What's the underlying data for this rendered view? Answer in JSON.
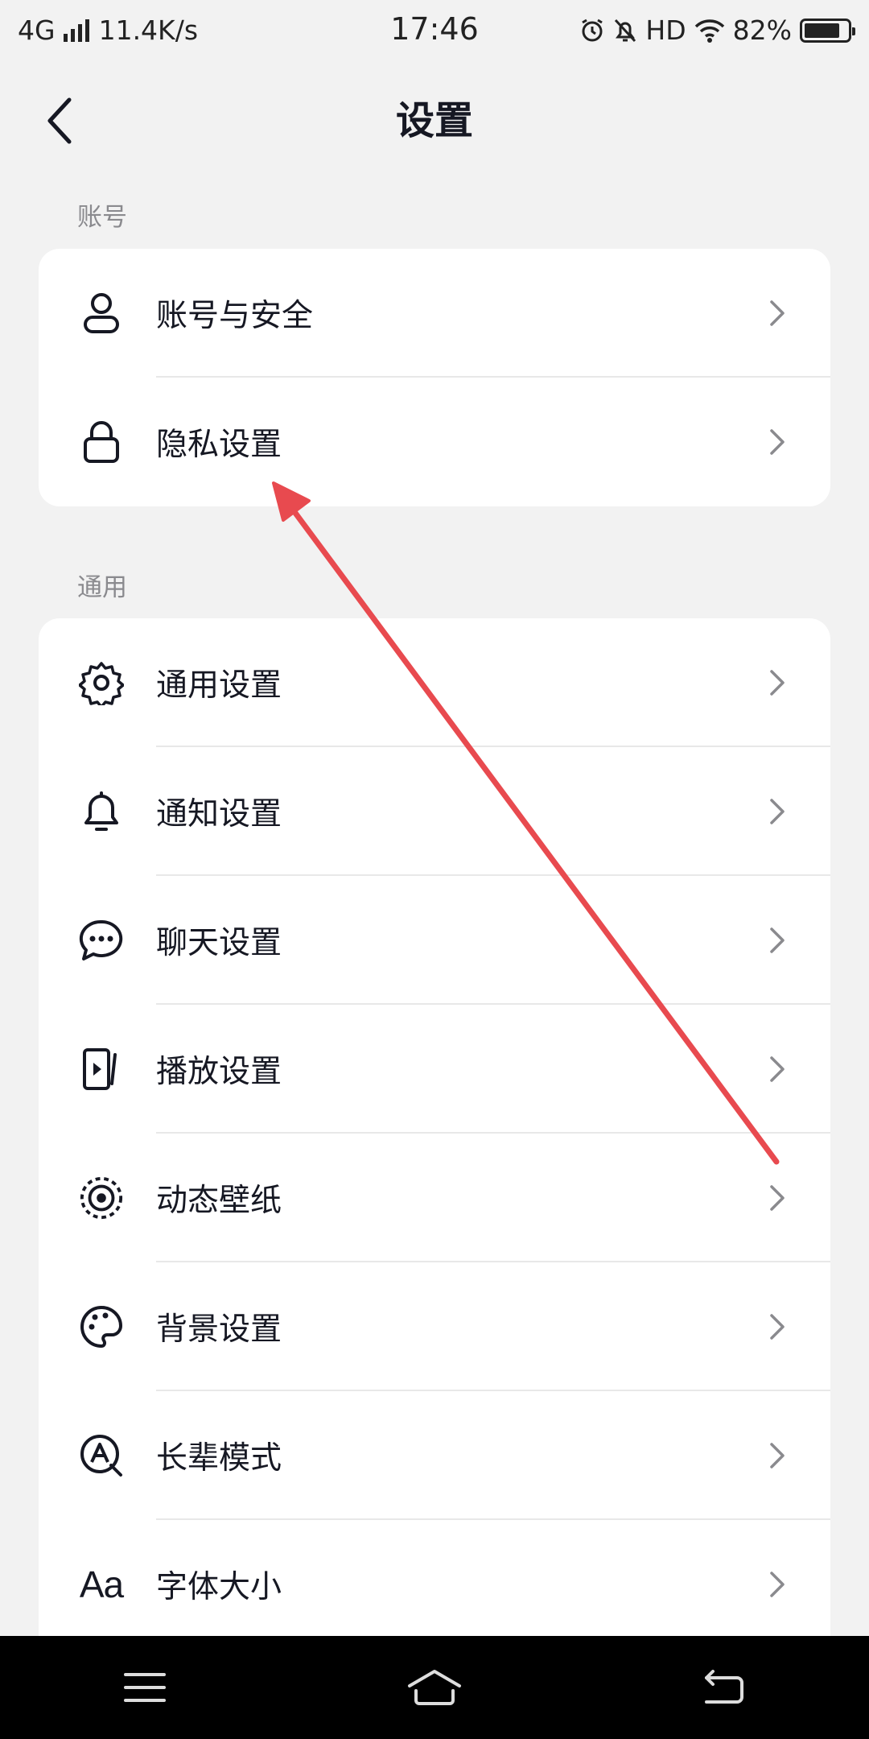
{
  "status_bar": {
    "network": "4G",
    "speed": "11.4K/s",
    "time": "17:46",
    "hd": "HD",
    "battery": "82%",
    "battery_level": 0.82
  },
  "header": {
    "title": "设置",
    "back_icon": "chevron-left-icon"
  },
  "sections": [
    {
      "label": "账号",
      "items": [
        {
          "label": "账号与安全",
          "icon": "person-icon"
        },
        {
          "label": "隐私设置",
          "icon": "lock-icon"
        }
      ]
    },
    {
      "label": "通用",
      "items": [
        {
          "label": "通用设置",
          "icon": "gear-icon"
        },
        {
          "label": "通知设置",
          "icon": "bell-icon"
        },
        {
          "label": "聊天设置",
          "icon": "chat-bubble-icon"
        },
        {
          "label": "播放设置",
          "icon": "play-screen-icon"
        },
        {
          "label": "动态壁纸",
          "icon": "dynamic-wallpaper-icon"
        },
        {
          "label": "背景设置",
          "icon": "palette-icon"
        },
        {
          "label": "长辈模式",
          "icon": "elder-mode-icon"
        },
        {
          "label": "字体大小",
          "icon": "font-size-icon",
          "icon_text": "Aa"
        }
      ]
    }
  ],
  "colors": {
    "background": "#f2f2f2",
    "card": "#ffffff",
    "annotation_arrow": "#e84a4f",
    "section_label": "#8a8a8e"
  },
  "bottom_nav": {
    "items": [
      "menu-icon",
      "home-icon",
      "back-icon"
    ]
  }
}
